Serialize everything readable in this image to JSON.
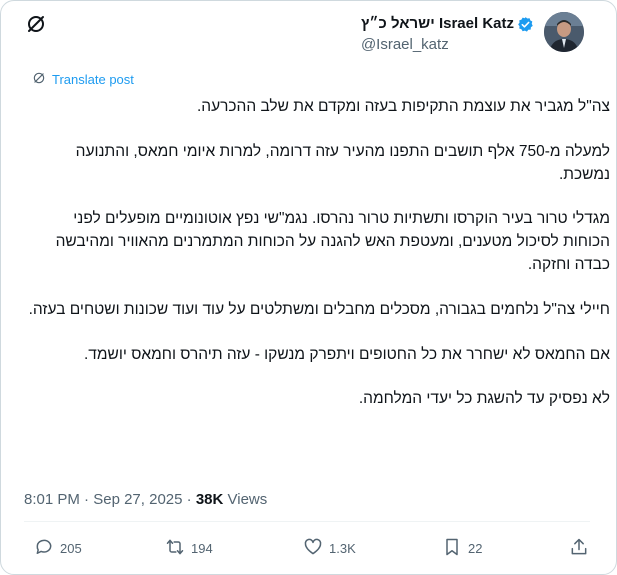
{
  "author": {
    "display_name": "ישראל כ״ץ Israel Katz",
    "handle": "@Israel_katz",
    "verified": true,
    "verified_color": "#1d9bf0"
  },
  "translate_label": "Translate post",
  "post_paragraphs": [
    "צה\"ל מגביר את עוצמת התקיפות בעזה  ומקדם את שלב ההכרעה.",
    "למעלה מ-750 אלף תושבים התפנו מהעיר עזה דרומה, למרות איומי חמאס, והתנועה נמשכת.",
    "מגדלי טרור בעיר הוקרסו ותשתיות טרור נהרסו. נגמ\"שי נפץ אוטונומיים מופעלים לפני הכוחות לסיכול מטענים, ומעטפת האש להגנה על הכוחות המתמרנים מהאוויר ומהיבשה כבדה וחזקה.",
    "חיילי צה\"ל נלחמים בגבורה, מסכלים מחבלים ומשתלטים על עוד ועוד שכונות ושטחים בעזה.",
    "אם החמאס לא ישחרר את כל החטופים ויתפרק מנשקו - עזה תיהרס וחמאס יושמד.",
    "לא נפסיק עד להשגת כל יעדי המלחמה."
  ],
  "meta": {
    "time": "8:01 PM",
    "separator": "·",
    "date": "Sep 27, 2025",
    "views_count": "38K",
    "views_label": "Views"
  },
  "actions": {
    "replies": "205",
    "reposts": "194",
    "likes": "1.3K",
    "bookmarks": "22"
  },
  "icons": [
    "grok-icon",
    "verified-badge-icon",
    "translate-icon",
    "reply-icon",
    "repost-icon",
    "like-icon",
    "bookmark-icon",
    "share-icon"
  ],
  "colors": {
    "accent": "#1d9bf0",
    "muted": "#536471",
    "text": "#0f1419"
  }
}
